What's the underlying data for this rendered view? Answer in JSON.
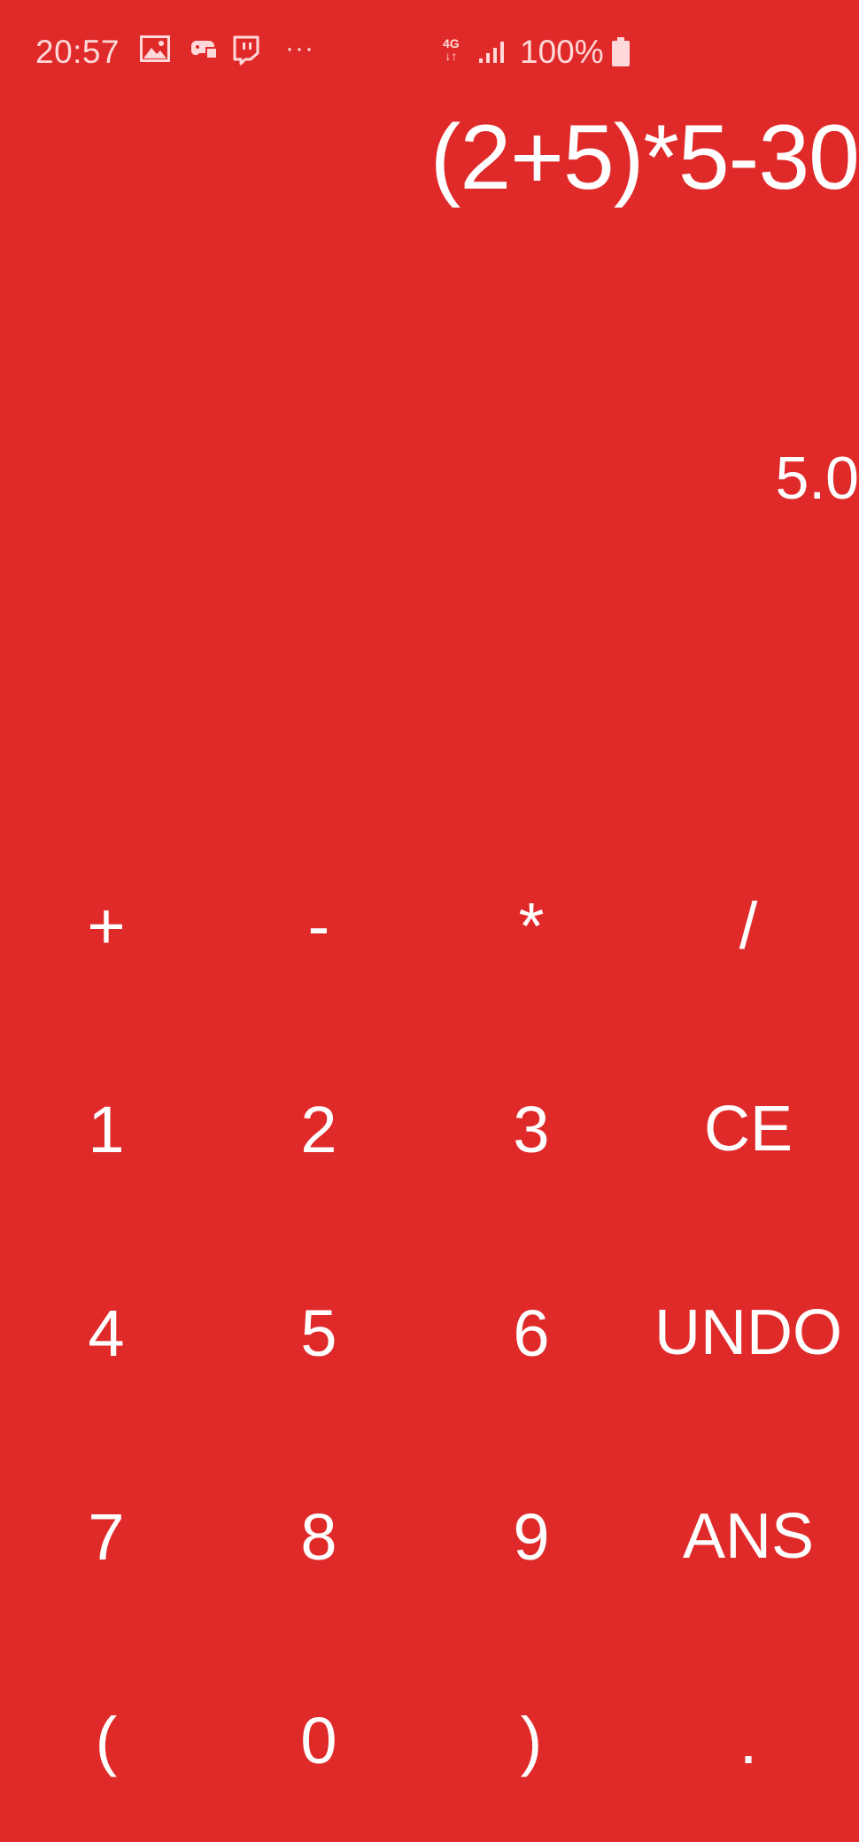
{
  "status_bar": {
    "time": "20:57",
    "network": "4G",
    "battery": "100%",
    "notification_icons": [
      "image-icon",
      "game-controller-icon",
      "twitch-icon",
      "more-dots-icon"
    ],
    "more_label": "···"
  },
  "display": {
    "expression": "(2+5)*5-30",
    "result": "5.0"
  },
  "keypad": {
    "rows": [
      [
        "+",
        "-",
        "*",
        "/"
      ],
      [
        "1",
        "2",
        "3",
        "CE"
      ],
      [
        "4",
        "5",
        "6",
        "UNDO"
      ],
      [
        "7",
        "8",
        "9",
        "ANS"
      ],
      [
        "(",
        "0",
        ")",
        "."
      ]
    ]
  },
  "colors": {
    "background": "#e02a2a",
    "text": "#ffffff",
    "status_text": "#ffd9d9"
  }
}
